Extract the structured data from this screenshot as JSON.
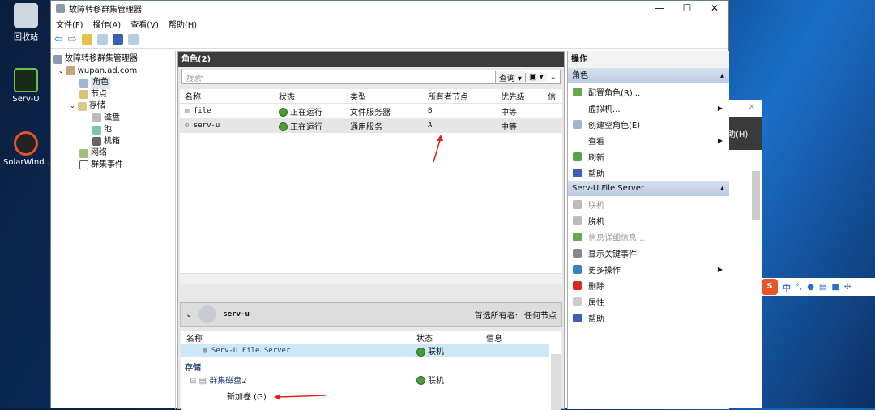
{
  "desktop": {
    "icons": [
      {
        "label": "回收站"
      },
      {
        "label": "Serv-U"
      },
      {
        "label": "SolarWind..."
      }
    ]
  },
  "window": {
    "title": "故障转移群集管理器",
    "controls": {
      "minimize": "—",
      "maximize": "☐",
      "close": "✕"
    }
  },
  "menu": [
    "文件(F)",
    "操作(A)",
    "查看(V)",
    "帮助(H)"
  ],
  "tree": {
    "root": "故障转移群集管理器",
    "cluster": "wupan.ad.com",
    "items": [
      "角色",
      "节点",
      "存储",
      "磁盘",
      "池",
      "机箱",
      "网络",
      "群集事件"
    ]
  },
  "roles": {
    "title": "角色(2)",
    "search_placeholder": "搜索",
    "query_btn": "查询",
    "columns": [
      "名称",
      "状态",
      "类型",
      "所有者节点",
      "优先级",
      "信"
    ],
    "rows": [
      {
        "name": "file",
        "status": "正在运行",
        "type": "文件服务器",
        "owner": "B",
        "priority": "中等"
      },
      {
        "name": "serv-u",
        "status": "正在运行",
        "type": "通用服务",
        "owner": "A",
        "priority": "中等"
      }
    ]
  },
  "detail": {
    "name": "serv-u",
    "preferred_owner_label": "首选所有者:",
    "preferred_owner": "任何节点",
    "columns": [
      "名称",
      "状态",
      "信息"
    ],
    "resource": {
      "name": "Serv-U File Server",
      "status": "联机"
    },
    "storage_label": "存储",
    "disk": {
      "name": "群集磁盘2",
      "status": "联机"
    },
    "volume": "新加卷 (G)"
  },
  "actions": {
    "title": "操作",
    "sections": [
      {
        "title": "角色",
        "items": [
          "配置角色(R)...",
          "虚拟机...",
          "创建空角色(E)",
          "查看",
          "刷新",
          "帮助"
        ]
      },
      {
        "title": "Serv-U File Server",
        "items": [
          "联机",
          "脱机",
          "信息详细信息...",
          "显示关键事件",
          "更多操作",
          "删除",
          "属性",
          "帮助"
        ]
      }
    ]
  },
  "background_window": {
    "menu_fragment": "助(H)",
    "close": "✕"
  },
  "ime": {
    "logo": "S",
    "lang": "中",
    "punct": "°,"
  },
  "colors": {
    "accent": "#3b6fb6",
    "selected": "#cde8f7",
    "arrow": "#e0221b"
  }
}
